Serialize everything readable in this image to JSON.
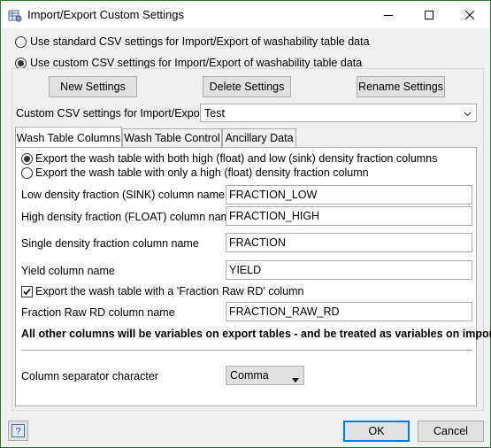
{
  "window": {
    "title": "Import/Export Custom Settings",
    "app_icon": "table-gear-icon",
    "controls": [
      "minimize-icon",
      "maximize-icon",
      "close-icon"
    ]
  },
  "mode": {
    "standard_label": "Use standard CSV settings for Import/Export of washability table data",
    "custom_label": "Use custom CSV settings for Import/Export of washability table data",
    "selected": "custom"
  },
  "actions": {
    "new_label": "New Settings",
    "delete_label": "Delete Settings",
    "rename_label": "Rename Settings"
  },
  "settings_select": {
    "label": "Custom CSV settings for Import/Export",
    "value": "Test"
  },
  "tabs": [
    {
      "label": "Wash Table Columns",
      "active": true
    },
    {
      "label": "Wash Table Control",
      "active": false
    },
    {
      "label": "Ancillary Data",
      "active": false
    }
  ],
  "wash_columns": {
    "export_both_label": "Export the wash table with both high (float) and low (sink) density fraction columns",
    "export_high_only_label": "Export the wash table with only a high (float) density fraction column",
    "export_selected": "both",
    "fields": [
      {
        "label": "Low density fraction (SINK) column name",
        "value": "FRACTION_LOW"
      },
      {
        "label": "High density fraction (FLOAT) column name",
        "value": "FRACTION_HIGH"
      },
      {
        "label": "Single density fraction column name",
        "value": "FRACTION"
      },
      {
        "label": "Yield column name",
        "value": "YIELD"
      }
    ],
    "raw_rd_checkbox_label": "Export the wash table with a 'Fraction Raw RD' column",
    "raw_rd_checked": true,
    "raw_rd_field": {
      "label": "Fraction Raw RD column name",
      "value": "FRACTION_RAW_RD"
    },
    "note": "All other columns will be variables on export tables - and be treated as variables on import.",
    "separator": {
      "label": "Column separator character",
      "value": "Comma"
    }
  },
  "footer": {
    "help_icon": "help-icon",
    "ok_label": "OK",
    "cancel_label": "Cancel"
  },
  "colors": {
    "accent": "#0078d7",
    "window_border": "#2b7a2b"
  }
}
